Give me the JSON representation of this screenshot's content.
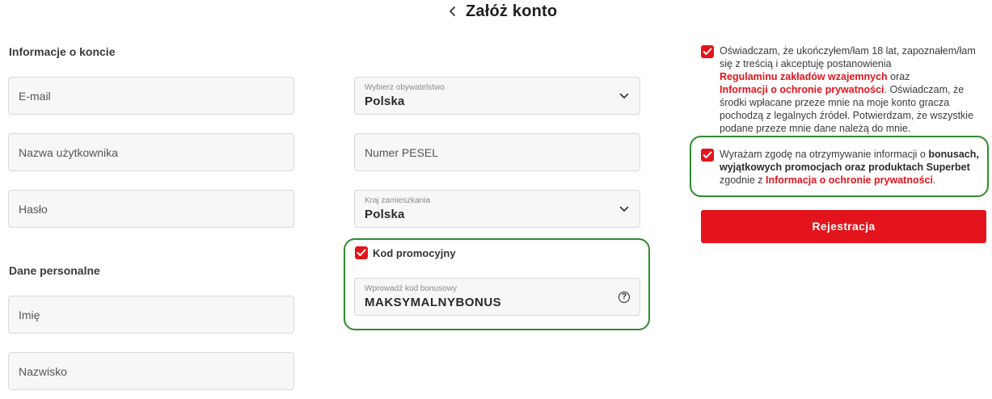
{
  "header": {
    "title": "Załóż konto"
  },
  "account_section": {
    "title": "Informacje o koncie",
    "email_placeholder": "E-mail",
    "username_placeholder": "Nazwa użytkownika",
    "password_placeholder": "Hasło"
  },
  "personal_section": {
    "title": "Dane personalne",
    "first_name_placeholder": "Imię",
    "last_name_placeholder": "Nazwisko"
  },
  "citizenship": {
    "label": "Wybierz obywatelstwo",
    "value": "Polska"
  },
  "pesel": {
    "placeholder": "Numer PESEL"
  },
  "residence": {
    "label": "Kraj zamieszkania",
    "value": "Polska"
  },
  "promo": {
    "checkbox_label": "Kod promocyjny",
    "checked": true,
    "input_label": "Wprowadź kod bonusowy",
    "input_value": "MAKSYMALNYBONUS"
  },
  "consents": {
    "terms": {
      "checked": true,
      "text_1": "Oświadczam, że ukończyłem/łam 18 lat, zapoznałem/łam się z treścią i akceptuję postanowienia",
      "link_1": "Regulaminu zakładów wzajemnych",
      "text_2": " oraz ",
      "link_2": "Informacji o ochronie prywatności",
      "text_3": ". Oświadczam, że środki wpłacane przeze mnie na moje konto gracza pochodzą z legalnych źródeł. Potwierdzam, że wszystkie podane przeze mnie dane należą do mnie."
    },
    "marketing": {
      "checked": true,
      "text_1": "Wyrażam zgodę na otrzymywanie informacji o ",
      "bold_1": "bonusach, wyjątkowych promocjach oraz produktach Superbet",
      "text_2": " zgodnie z ",
      "link_1": "Informacja o ochronie prywatności",
      "text_3": "."
    }
  },
  "register_button": {
    "label": "Rejestracja"
  },
  "colors": {
    "brand_red": "#e3141b",
    "highlight_green": "#2e8b2e"
  }
}
